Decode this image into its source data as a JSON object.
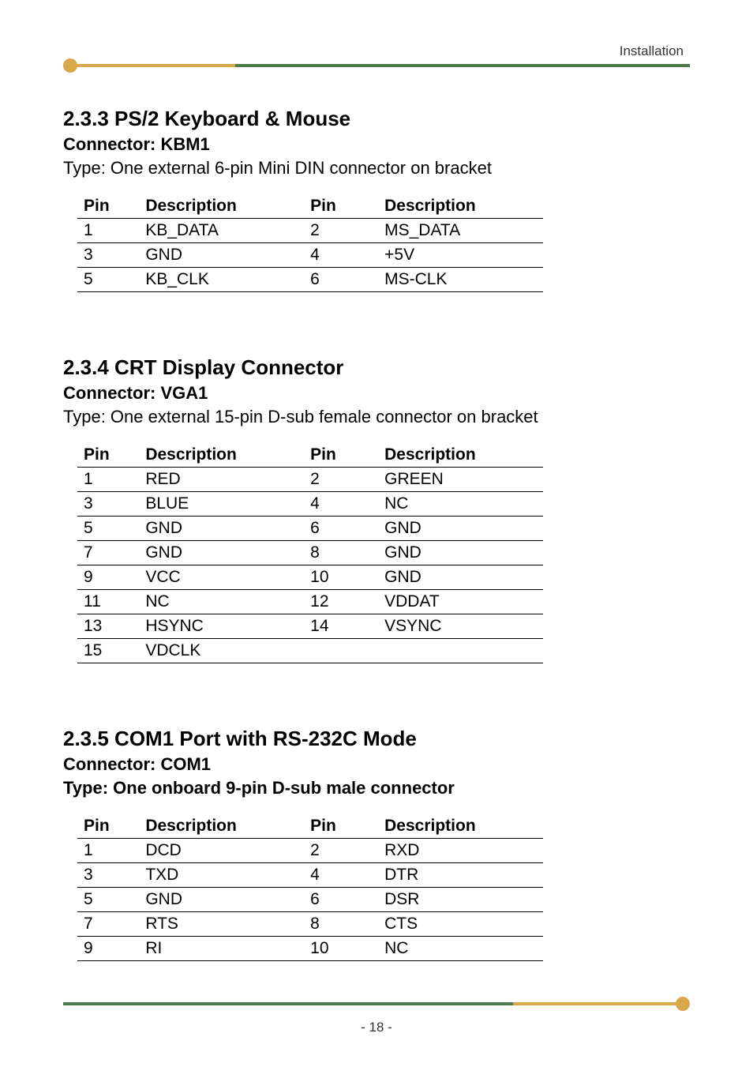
{
  "header": {
    "label": "Installation"
  },
  "section1": {
    "title": "2.3.3 PS/2 Keyboard & Mouse",
    "connector": "Connector: KBM1",
    "type": "Type: One external 6-pin Mini DIN connector on bracket",
    "headers": [
      "Pin",
      "Description",
      "Pin",
      "Description"
    ],
    "rows": [
      [
        "1",
        "KB_DATA",
        "2",
        "MS_DATA"
      ],
      [
        "3",
        "GND",
        "4",
        "+5V"
      ],
      [
        "5",
        "KB_CLK",
        "6",
        "MS-CLK"
      ]
    ]
  },
  "section2": {
    "title": "2.3.4 CRT Display Connector",
    "connector": "Connector: VGA1",
    "type": "Type: One external 15-pin D-sub female connector on bracket",
    "headers": [
      "Pin",
      "Description",
      "Pin",
      "Description"
    ],
    "rows": [
      [
        "1",
        "RED",
        "2",
        "GREEN"
      ],
      [
        "3",
        "BLUE",
        "4",
        "NC"
      ],
      [
        "5",
        "GND",
        "6",
        "GND"
      ],
      [
        "7",
        "GND",
        "8",
        "GND"
      ],
      [
        "9",
        "VCC",
        "10",
        "GND"
      ],
      [
        "11",
        "NC",
        "12",
        "VDDAT"
      ],
      [
        "13",
        "HSYNC",
        "14",
        "VSYNC"
      ],
      [
        "15",
        "VDCLK",
        "",
        ""
      ]
    ]
  },
  "section3": {
    "title": "2.3.5 COM1 Port with RS-232C Mode",
    "connector": "Connector: COM1",
    "type": "Type: One onboard 9-pin D-sub male connector",
    "headers": [
      "Pin",
      "Description",
      "Pin",
      "Description"
    ],
    "rows": [
      [
        "1",
        "DCD",
        "2",
        "RXD"
      ],
      [
        "3",
        "TXD",
        "4",
        "DTR"
      ],
      [
        "5",
        "GND",
        "6",
        "DSR"
      ],
      [
        "7",
        "RTS",
        "8",
        "CTS"
      ],
      [
        "9",
        "RI",
        "10",
        "NC"
      ]
    ]
  },
  "footer": {
    "page": "- 18 -"
  }
}
